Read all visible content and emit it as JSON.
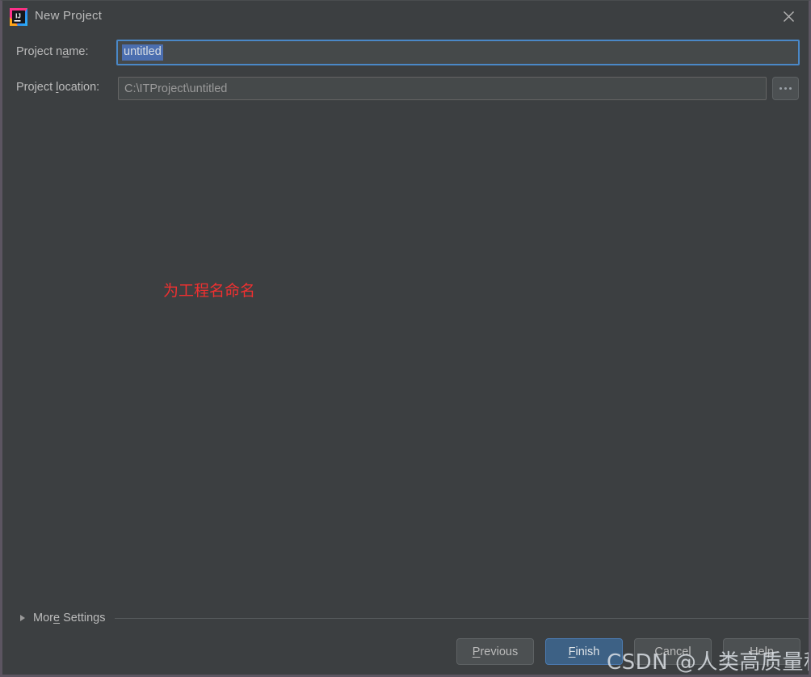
{
  "window": {
    "title": "New Project",
    "app_icon": "intellij-idea-icon",
    "close_icon": "close-icon",
    "background_color": "#3c3f41",
    "border_color": "#5c5561"
  },
  "form": {
    "project_name": {
      "label_before": "Project n",
      "label_mnemonic": "a",
      "label_after": "me:",
      "value": "untitled",
      "placeholder": "untitled",
      "selected": true,
      "focus_border_color": "#4a88c7",
      "selection_color": "#4b6eaf"
    },
    "project_location": {
      "label_before": "Project ",
      "label_mnemonic": "l",
      "label_after": "ocation:",
      "value": "C:\\ITProject\\untitled",
      "placeholder": "C:\\ITProject\\untitled",
      "browse_label": "...",
      "browse_icon": "ellipsis-icon"
    }
  },
  "annotation": {
    "text": "为工程名命名",
    "color": "#f03030"
  },
  "more_settings": {
    "label_before": "Mor",
    "label_mnemonic": "e",
    "label_after": " Settings",
    "expanded": false,
    "expand_icon": "chevron-right-icon"
  },
  "buttons": [
    {
      "name": "previous-button",
      "label_before": "",
      "label_mnemonic": "P",
      "label_after": "revious",
      "primary": false
    },
    {
      "name": "finish-button",
      "label_before": "",
      "label_mnemonic": "F",
      "label_after": "inish",
      "primary": true,
      "color": "#3d6185"
    },
    {
      "name": "cancel-button",
      "label_before": "Cancel",
      "label_mnemonic": "",
      "label_after": "",
      "primary": false
    },
    {
      "name": "help-button",
      "label_before": "Help",
      "label_mnemonic": "",
      "label_after": "",
      "primary": false
    }
  ],
  "watermark": {
    "text": "CSDN @人类高质量程序员"
  }
}
